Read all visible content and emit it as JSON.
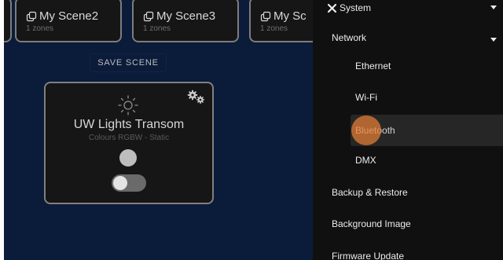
{
  "scenes": [
    {
      "title": "My Scene2",
      "zones": "1 zones"
    },
    {
      "title": "My Scene3",
      "zones": "1 zones"
    },
    {
      "title": "My Sc",
      "zones": "1 zones"
    }
  ],
  "save_scene_label": "SAVE SCENE",
  "zone": {
    "title": "UW Lights Transom",
    "subtitle": "Colours RGBW - Static",
    "toggle_on": false
  },
  "menu": {
    "system": "System",
    "network": "Network",
    "network_items": [
      "Ethernet",
      "Wi-Fi",
      "Bluetooth",
      "DMX"
    ],
    "backup": "Backup & Restore",
    "background": "Background Image",
    "firmware": "Firmware Update"
  },
  "colors": {
    "background": "#0b1b3a",
    "card": "#161616",
    "menu": "#101010",
    "touch": "#e88036"
  }
}
